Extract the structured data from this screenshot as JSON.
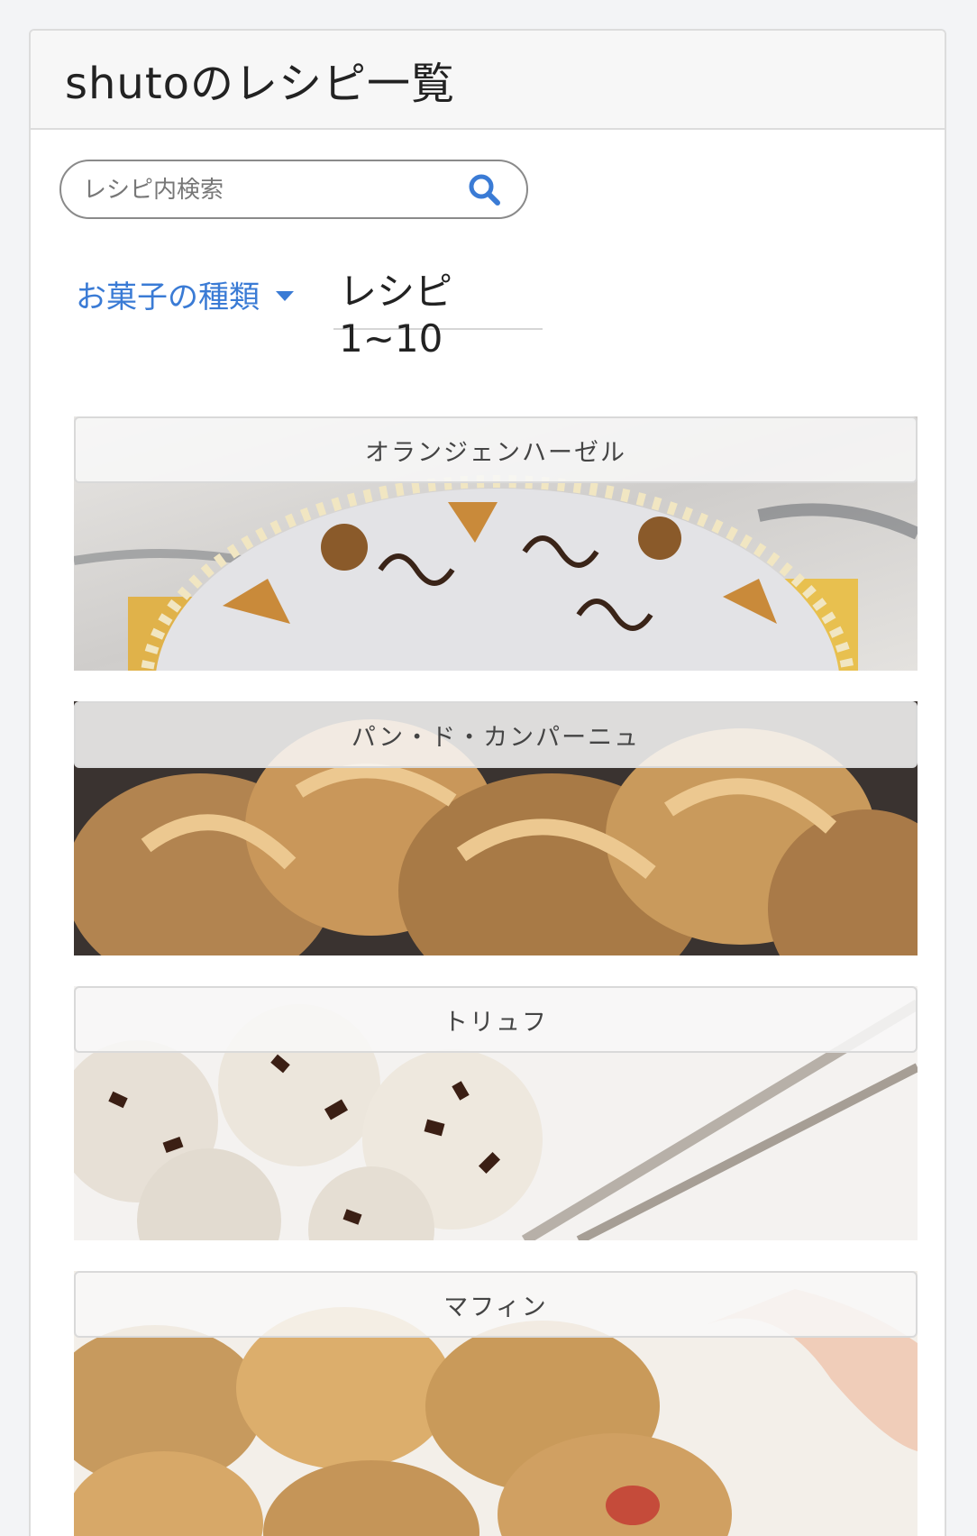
{
  "header": {
    "title": "shutoのレシピ一覧"
  },
  "search": {
    "placeholder": "レシピ内検索",
    "icon": "search-icon"
  },
  "filter": {
    "dropdown_label": "お菓子の種類"
  },
  "tab": {
    "label": "レシピ1~10"
  },
  "colors": {
    "accent": "#3a7bd5",
    "header_bg": "#f7f7f7",
    "page_bg": "#f3f4f6"
  },
  "recipes": [
    {
      "name": "オランジェンハーゼル"
    },
    {
      "name": "パン・ド・カンパーニュ"
    },
    {
      "name": "トリュフ"
    },
    {
      "name": "マフィン"
    }
  ]
}
